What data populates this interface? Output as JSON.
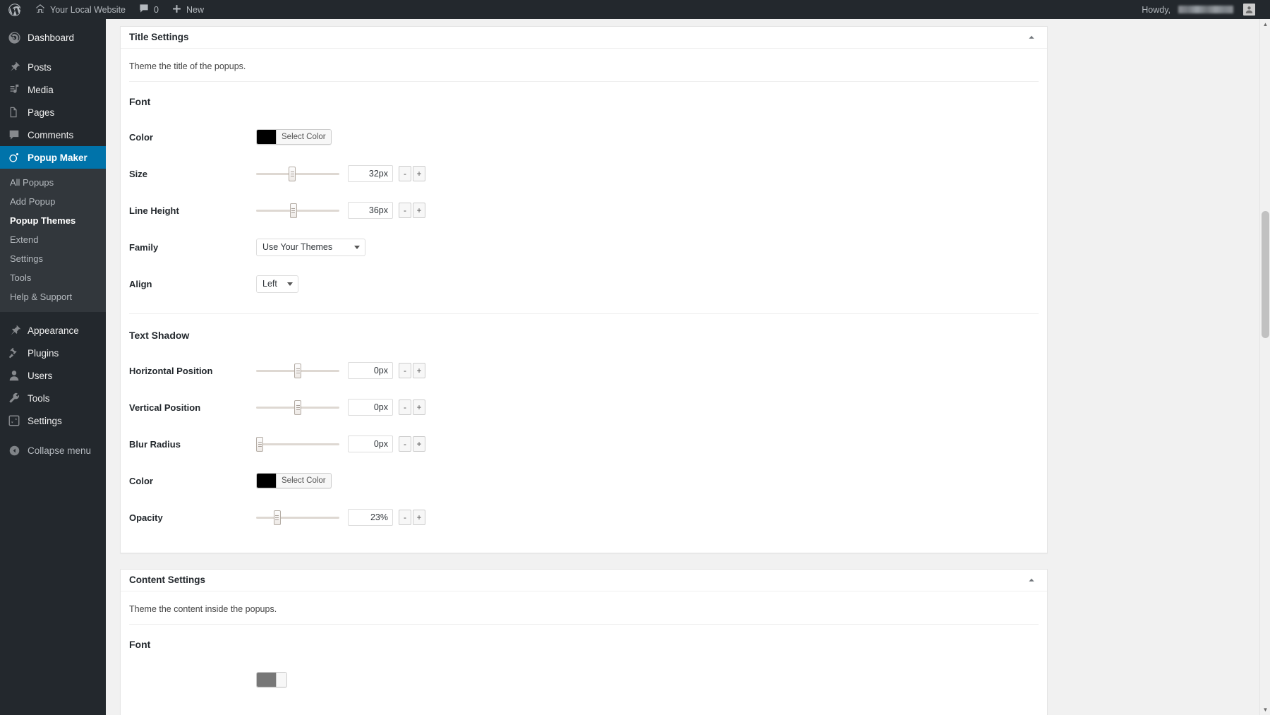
{
  "adminbar": {
    "wp_logo": "wordpress-logo",
    "site_name": "Your Local Website",
    "comment_count": "0",
    "new_label": "New",
    "howdy_label": "Howdy,",
    "username_redacted": true
  },
  "sidebar": {
    "items": [
      {
        "label": "Dashboard",
        "icon": "dashboard-icon",
        "current": false
      },
      {
        "label": "Posts",
        "icon": "pin-icon",
        "current": false
      },
      {
        "label": "Media",
        "icon": "media-icon",
        "current": false
      },
      {
        "label": "Pages",
        "icon": "pages-icon",
        "current": false
      },
      {
        "label": "Comments",
        "icon": "comments-icon",
        "current": false
      },
      {
        "label": "Popup Maker",
        "icon": "popup-maker-icon",
        "current": true
      }
    ],
    "submenu": [
      {
        "label": "All Popups",
        "current": false
      },
      {
        "label": "Add Popup",
        "current": false
      },
      {
        "label": "Popup Themes",
        "current": true
      },
      {
        "label": "Extend",
        "current": false
      },
      {
        "label": "Settings",
        "current": false
      },
      {
        "label": "Tools",
        "current": false
      },
      {
        "label": "Help & Support",
        "current": false
      }
    ],
    "items_bottom": [
      {
        "label": "Appearance",
        "icon": "appearance-icon"
      },
      {
        "label": "Plugins",
        "icon": "plugins-icon"
      },
      {
        "label": "Users",
        "icon": "users-icon"
      },
      {
        "label": "Tools",
        "icon": "tools-icon"
      },
      {
        "label": "Settings",
        "icon": "settings-icon"
      }
    ],
    "collapse": {
      "label": "Collapse menu",
      "icon": "collapse-icon"
    }
  },
  "title_settings": {
    "heading": "Title Settings",
    "description": "Theme the title of the popups.",
    "font_group": "Font",
    "shadow_group": "Text Shadow",
    "font": {
      "color": {
        "label": "Color",
        "swatch": "#000000",
        "button": "Select Color"
      },
      "size": {
        "label": "Size",
        "value": "32px",
        "percent": 43
      },
      "line_height": {
        "label": "Line Height",
        "value": "36px",
        "percent": 44
      },
      "family": {
        "label": "Family",
        "value": "Use Your Themes"
      },
      "align": {
        "label": "Align",
        "value": "Left"
      }
    },
    "shadow": {
      "horizontal": {
        "label": "Horizontal Position",
        "value": "0px",
        "percent": 50
      },
      "vertical": {
        "label": "Vertical Position",
        "value": "0px",
        "percent": 50
      },
      "blur": {
        "label": "Blur Radius",
        "value": "0px",
        "percent": 0
      },
      "color": {
        "label": "Color",
        "swatch": "#000000",
        "button": "Select Color"
      },
      "opacity": {
        "label": "Opacity",
        "value": "23%",
        "percent": 23
      }
    }
  },
  "content_settings": {
    "heading": "Content Settings",
    "description": "Theme the content inside the popups.",
    "font_group": "Font"
  },
  "stepper": {
    "minus": "-",
    "plus": "+"
  },
  "colors": {
    "accent": "#0073aa",
    "adminbar_bg": "#23282d",
    "submenu_bg": "#32373c"
  }
}
